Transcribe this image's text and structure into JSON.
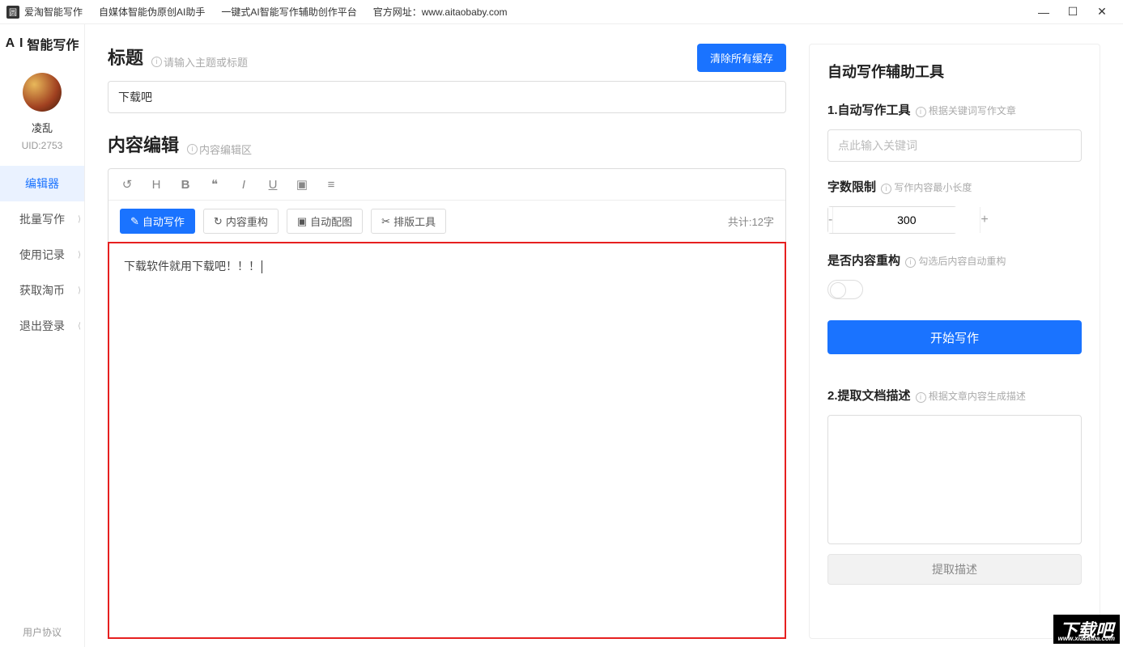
{
  "titlebar": {
    "app_name": "爱淘智能写作",
    "subtitle1": "自媒体智能伪原创AI助手",
    "subtitle2": "一键式AI智能写作辅助创作平台",
    "site_label": "官方网址：",
    "site_url": "www.aitaobaby.com"
  },
  "sidebar": {
    "logo_prefix": "A I",
    "logo_text": "智能写作",
    "username": "凌乱",
    "uid": "UID:2753",
    "items": [
      {
        "label": "编辑器"
      },
      {
        "label": "批量写作"
      },
      {
        "label": "使用记录"
      },
      {
        "label": "获取淘币"
      },
      {
        "label": "退出登录"
      }
    ],
    "footer": "用户协议"
  },
  "editor": {
    "title_label": "标题",
    "title_hint": "请输入主题或标题",
    "clear_btn": "清除所有缓存",
    "title_value": "下载吧",
    "content_label": "内容编辑",
    "content_hint": "内容编辑区",
    "btn_auto": "自动写作",
    "btn_restructure": "内容重构",
    "btn_autoimg": "自动配图",
    "btn_layout": "排版工具",
    "count_label": "共计:12字",
    "body_text": "下载软件就用下载吧！！！"
  },
  "rightPanel": {
    "heading": "自动写作辅助工具",
    "sec1_title": "1.自动写作工具",
    "sec1_hint": "根据关键词写作文章",
    "keyword_placeholder": "点此输入关键词",
    "word_limit_label": "字数限制",
    "word_limit_hint": "写作内容最小长度",
    "word_limit_value": "300",
    "restructure_label": "是否内容重构",
    "restructure_hint": "勾选后内容自动重构",
    "start_btn": "开始写作",
    "sec2_title": "2.提取文档描述",
    "sec2_hint": "根据文章内容生成描述",
    "extract_btn": "提取描述"
  },
  "watermark": {
    "text": "下载吧",
    "url": "www.xiazaiba.com"
  }
}
